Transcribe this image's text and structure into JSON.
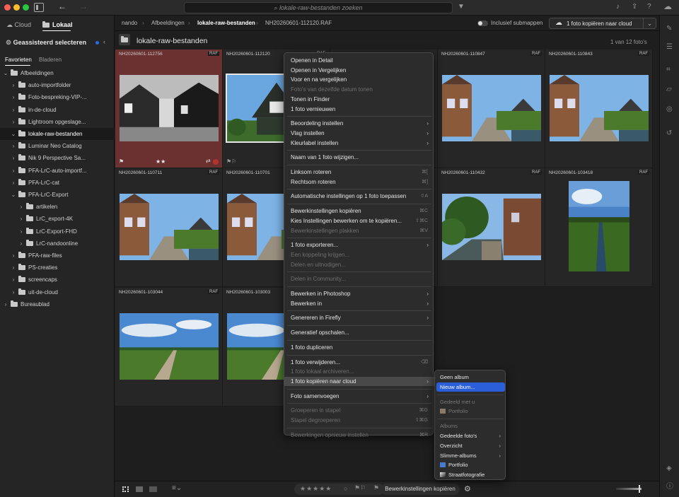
{
  "window": {
    "search_placeholder": "lokale-raw-bestanden zoeken"
  },
  "sidebar": {
    "source_cloud": "Cloud",
    "source_local": "Lokaal",
    "heading": "Geassisteerd selecteren",
    "tabs": [
      "Favorieten",
      "Bladeren"
    ],
    "tree": [
      {
        "label": "Afbeeldingen",
        "depth": 0,
        "expanded": true
      },
      {
        "label": "auto-importfolder",
        "depth": 1,
        "expanded": false
      },
      {
        "label": "Foto-bespreking-VIP-...",
        "depth": 1,
        "expanded": false
      },
      {
        "label": "in-de-cloud",
        "depth": 1,
        "expanded": false
      },
      {
        "label": "Lightroom opgeslage...",
        "depth": 1,
        "expanded": false
      },
      {
        "label": "lokale-raw-bestanden",
        "depth": 1,
        "expanded": true,
        "selected": true
      },
      {
        "label": "Luminar Neo Catalog",
        "depth": 1,
        "expanded": false
      },
      {
        "label": "Nik 9 Perspective Sa...",
        "depth": 1,
        "expanded": false
      },
      {
        "label": "PFA-LrC-auto-importf...",
        "depth": 1,
        "expanded": false
      },
      {
        "label": "PFA-LrC-cat",
        "depth": 1,
        "expanded": false
      },
      {
        "label": "PFA-LrC-Export",
        "depth": 1,
        "expanded": true
      },
      {
        "label": "artikelen",
        "depth": 2,
        "expanded": false
      },
      {
        "label": "LrC_export-4K",
        "depth": 2,
        "expanded": false
      },
      {
        "label": "LrC-Export-FHD",
        "depth": 2,
        "expanded": false
      },
      {
        "label": "LrC-nandoonline",
        "depth": 2,
        "expanded": false
      },
      {
        "label": "PFA-raw-files",
        "depth": 1,
        "expanded": false
      },
      {
        "label": "PS-creaties",
        "depth": 1,
        "expanded": false
      },
      {
        "label": "screencaps",
        "depth": 1,
        "expanded": false
      },
      {
        "label": "uit-de-cloud",
        "depth": 1,
        "expanded": false
      },
      {
        "label": "Bureaublad",
        "depth": 0,
        "expanded": false
      }
    ]
  },
  "topbar": {
    "breadcrumb": [
      "nando",
      "Afbeeldingen",
      "lokale-raw-bestanden",
      "NH20260601-112120.RAF"
    ],
    "include_subfolders": "Inclusief submappen",
    "copy_to_cloud": "1 foto kopiëren naar cloud"
  },
  "folder": {
    "title": "lokale-raw-bestanden",
    "count": "1 van 12 foto's"
  },
  "grid": {
    "raw_badge": "RAF",
    "photos": [
      {
        "name": "NH20260601-112756",
        "scene": "bw"
      },
      {
        "name": "NH20260601-112120",
        "scene": "house"
      },
      {
        "name": "",
        "scene": "hidden"
      },
      {
        "name": "NH20260601-110847",
        "scene": "street"
      },
      {
        "name": "NH20260601-110843",
        "scene": "street"
      },
      {
        "name": "NH20260601-110711",
        "scene": "street"
      },
      {
        "name": "NH20260601-110701",
        "scene": "street"
      },
      {
        "name": "",
        "scene": "hidden"
      },
      {
        "name": "NH20260601-110432",
        "scene": "canal"
      },
      {
        "name": "NH20260601-103418",
        "scene": "ditch"
      },
      {
        "name": "NH20260601-103044",
        "scene": "field"
      },
      {
        "name": "NH20260601-103003",
        "scene": "field"
      }
    ]
  },
  "context_menu": {
    "items": [
      {
        "label": "Openen in Detail",
        "enabled": true
      },
      {
        "label": "Openen in Vergelijken",
        "enabled": true
      },
      {
        "label": "Voor en na vergelijken",
        "enabled": true
      },
      {
        "label": "Foto's van dezelfde datum tonen",
        "enabled": false
      },
      {
        "label": "Tonen in Finder",
        "enabled": true
      },
      {
        "label": "1 foto vernieuwen",
        "enabled": true
      },
      {
        "sep": true
      },
      {
        "label": "Beoordeling instellen",
        "enabled": true,
        "submenu": true
      },
      {
        "label": "Vlag instellen",
        "enabled": true,
        "submenu": true
      },
      {
        "label": "Kleurlabel instellen",
        "enabled": true,
        "submenu": true
      },
      {
        "sep": true
      },
      {
        "label": "Naam van 1 foto wijzigen...",
        "enabled": true
      },
      {
        "sep": true
      },
      {
        "label": "Linksom roteren",
        "enabled": true,
        "shortcut": "⌘["
      },
      {
        "label": "Rechtsom roteren",
        "enabled": true,
        "shortcut": "⌘]"
      },
      {
        "sep": true
      },
      {
        "label": "Automatische instellingen op 1 foto toepassen",
        "enabled": true,
        "shortcut": "⇧A"
      },
      {
        "sep": true
      },
      {
        "label": "Bewerkinstellingen kopiëren",
        "enabled": true,
        "shortcut": "⌘C"
      },
      {
        "label": "Kies Instellingen bewerken om te kopiëren...",
        "enabled": true,
        "shortcut": "⇧⌘C"
      },
      {
        "label": "Bewerkinstellingen plakken",
        "enabled": false,
        "shortcut": "⌘V"
      },
      {
        "sep": true
      },
      {
        "label": "1 foto exporteren...",
        "enabled": true,
        "submenu": true
      },
      {
        "label": "Een koppeling krijgen...",
        "enabled": false
      },
      {
        "label": "Delen en uitnodigen...",
        "enabled": false
      },
      {
        "sep": true
      },
      {
        "label": "Delen in Community...",
        "enabled": false
      },
      {
        "sep": true
      },
      {
        "label": "Bewerken in Photoshop",
        "enabled": true,
        "submenu": true
      },
      {
        "label": "Bewerken in",
        "enabled": true,
        "submenu": true
      },
      {
        "sep": true
      },
      {
        "label": "Genereren in Firefly",
        "enabled": true,
        "submenu": true
      },
      {
        "sep": true
      },
      {
        "label": "Generatief opschalen...",
        "enabled": true
      },
      {
        "sep": true
      },
      {
        "label": "1 foto dupliceren",
        "enabled": true
      },
      {
        "sep": true
      },
      {
        "label": "1 foto verwijderen...",
        "enabled": true,
        "shortcut": "⌫"
      },
      {
        "label": "1 foto lokaal archiveren...",
        "enabled": false
      },
      {
        "label": "1 foto kopiëren naar cloud",
        "enabled": true,
        "submenu": true,
        "highlight": true
      },
      {
        "sep": true
      },
      {
        "label": "Foto samenvoegen",
        "enabled": true,
        "submenu": true
      },
      {
        "sep": true
      },
      {
        "label": "Groeperen in stapel",
        "enabled": false,
        "shortcut": "⌘G"
      },
      {
        "label": "Stapel degroeperen",
        "enabled": false,
        "shortcut": "⇧⌘G"
      },
      {
        "sep": true
      },
      {
        "label": "Bewerkingen opnieuw instellen",
        "enabled": false,
        "shortcut": "⌘R"
      }
    ]
  },
  "submenu": {
    "items": [
      {
        "label": "Geen album",
        "kind": "item"
      },
      {
        "label": "Nieuw album...",
        "kind": "item",
        "highlight": true
      },
      {
        "sep": true
      },
      {
        "label": "Gedeeld met u",
        "kind": "header"
      },
      {
        "label": "Portfolio",
        "kind": "item",
        "disabled": true,
        "thumb": true
      },
      {
        "sep": true
      },
      {
        "label": "Albums",
        "kind": "header"
      },
      {
        "label": "Gedeelde foto's",
        "kind": "item",
        "submenu": true
      },
      {
        "label": "Overzicht",
        "kind": "item",
        "submenu": true
      },
      {
        "label": "Slimme-albums",
        "kind": "item",
        "submenu": true
      },
      {
        "label": "Portfolio",
        "kind": "item",
        "thumb": "blue"
      },
      {
        "label": "Straatfotografie",
        "kind": "item",
        "thumb": "bw"
      }
    ]
  },
  "bottombar": {
    "copy_edit_settings": "Bewerkinstellingen kopiëren"
  },
  "colors": {
    "accent": "#2b5fd9",
    "selected_cell": "#6b3030",
    "rating_red": "#b3332e"
  }
}
